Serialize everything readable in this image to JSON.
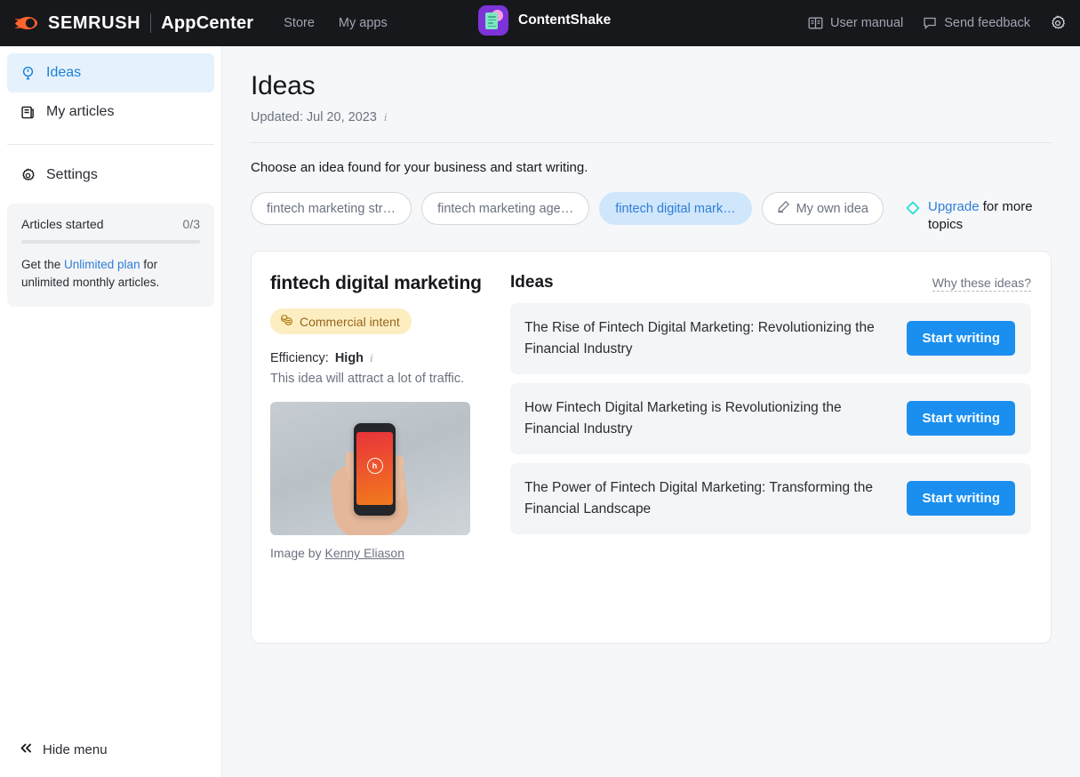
{
  "topbar": {
    "logo_text": "SEMRUSH",
    "product": "AppCenter",
    "nav": [
      {
        "label": "Store"
      },
      {
        "label": "My apps"
      }
    ],
    "app_name": "ContentShake",
    "right_items": [
      {
        "label": "User manual",
        "icon": "book-icon"
      },
      {
        "label": "Send feedback",
        "icon": "chat-bubble-icon"
      }
    ],
    "settings_icon": "gear-icon"
  },
  "sidebar": {
    "items": [
      {
        "label": "Ideas",
        "icon": "lightbulb-pin-icon",
        "active": true
      },
      {
        "label": "My articles",
        "icon": "articles-icon",
        "active": false
      },
      {
        "label": "Settings",
        "icon": "gear-icon",
        "active": false
      }
    ],
    "usage": {
      "label": "Articles started",
      "count": "0/3",
      "progress_percent": 0,
      "promo_prefix": "Get the ",
      "promo_link": "Unlimited plan",
      "promo_suffix": " for unlimited monthly articles."
    },
    "hide_menu_label": "Hide menu"
  },
  "main": {
    "title": "Ideas",
    "updated_label": "Updated: Jul 20, 2023",
    "subtitle": "Choose an idea found for your business and start writing.",
    "chips": [
      {
        "label": "fintech marketing str…",
        "selected": false
      },
      {
        "label": "fintech marketing age…",
        "selected": false
      },
      {
        "label": "fintech digital mark…",
        "selected": true
      }
    ],
    "own_idea_chip": {
      "label": "My own idea",
      "icon": "pencil-icon"
    },
    "upgrade": {
      "link": "Upgrade",
      "rest": " for more topics",
      "icon": "diamond-icon"
    }
  },
  "detail": {
    "keyword": "fintech digital marketing",
    "intent_badge": "Commercial intent",
    "intent_icon": "coins-icon",
    "efficiency_label": "Efficiency:",
    "efficiency_value": "High",
    "efficiency_desc": "This idea will attract a lot of traffic.",
    "image_credit_prefix": "Image by ",
    "image_credit_author": "Kenny Eliason"
  },
  "ideas_panel": {
    "heading": "Ideas",
    "why_link": "Why these ideas?",
    "cta_label": "Start writing",
    "items": [
      {
        "title": "The Rise of Fintech Digital Marketing: Revolutionizing the Financial Industry"
      },
      {
        "title": "How Fintech Digital Marketing is Revolutionizing the Financial Industry"
      },
      {
        "title": "The Power of Fintech Digital Marketing: Transforming the Financial Landscape"
      }
    ]
  },
  "colors": {
    "topbar_bg": "#17181c",
    "accent_blue": "#1a8ff0",
    "link_blue": "#2f7ed8",
    "active_nav_bg": "#e5f2fd",
    "chip_selected_bg": "#cfe6fb",
    "badge_bg": "#fdeec2",
    "badge_text": "#96651a",
    "page_bg": "#f6f7f9"
  }
}
